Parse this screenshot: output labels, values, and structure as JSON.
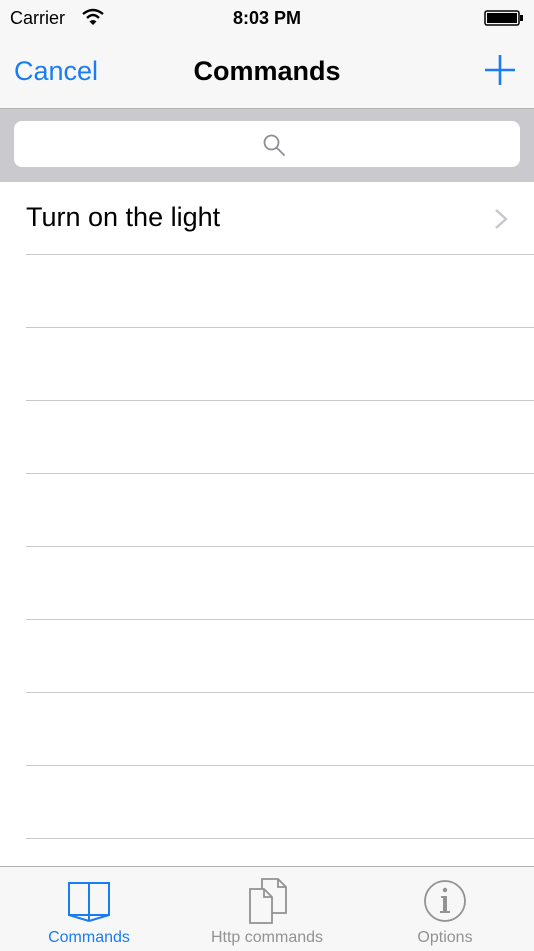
{
  "status_bar": {
    "carrier": "Carrier",
    "time": "8:03 PM"
  },
  "nav": {
    "cancel_label": "Cancel",
    "title": "Commands",
    "add_icon": "plus-icon"
  },
  "search": {
    "placeholder": "",
    "icon": "search-icon"
  },
  "commands": [
    {
      "label": "Turn on the light"
    }
  ],
  "tabs": [
    {
      "label": "Commands",
      "icon": "book-icon",
      "active": true
    },
    {
      "label": "Http commands",
      "icon": "documents-icon",
      "active": false
    },
    {
      "label": "Options",
      "icon": "info-icon",
      "active": false
    }
  ],
  "colors": {
    "accent": "#1a7cf5",
    "inactive": "#929292",
    "search_bg": "#c9c9ce"
  }
}
